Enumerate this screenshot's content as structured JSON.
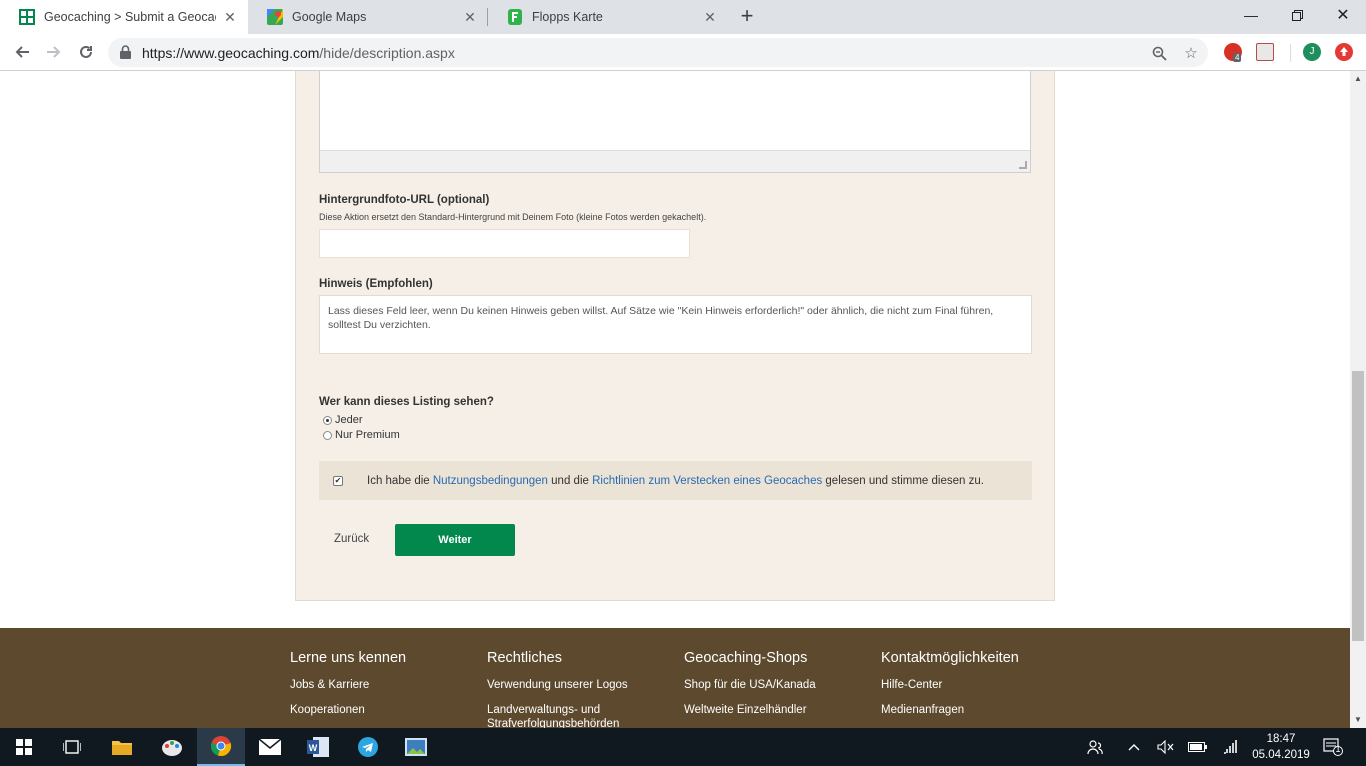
{
  "browser": {
    "tabs": [
      {
        "title": "Geocaching > Submit a Geocach",
        "active": true,
        "icon": "geocaching-icon"
      },
      {
        "title": "Google Maps",
        "active": false,
        "icon": "google-maps-icon"
      },
      {
        "title": "Flopps Karte",
        "active": false,
        "icon": "flopps-icon"
      }
    ],
    "url_domain": "https://www.geocaching.com",
    "url_path": "/hide/description.aspx",
    "profile_initial": "J",
    "extension_badge": "4"
  },
  "form": {
    "background_label": "Hintergrundfoto-URL (optional)",
    "background_hint": "Diese Aktion ersetzt den Standard-Hintergrund mit Deinem Foto (kleine Fotos werden gekachelt).",
    "background_value": "",
    "hint_label": "Hinweis (Empfohlen)",
    "hint_placeholder": "Lass dieses Feld leer, wenn Du keinen Hinweis geben willst. Auf Sätze wie \"Kein Hinweis erforderlich!\" oder ähnlich, die nicht zum Final führen, solltest Du verzichten.",
    "visibility_label": "Wer kann dieses Listing sehen?",
    "visibility_options": [
      "Jeder",
      "Nur Premium"
    ],
    "visibility_selected": "Jeder",
    "terms_prefix": "Ich habe die ",
    "terms_link1": "Nutzungsbedingungen",
    "terms_middle": " und die ",
    "terms_link2": "Richtlinien zum Verstecken eines Geocaches",
    "terms_suffix": " gelesen und stimme diesen zu.",
    "terms_checked": true,
    "back_label": "Zurück",
    "next_label": "Weiter"
  },
  "footer": {
    "columns": [
      {
        "heading": "Lerne uns kennen",
        "links": [
          "Jobs & Karriere",
          "Kooperationen"
        ]
      },
      {
        "heading": "Rechtliches",
        "links": [
          "Verwendung unserer Logos",
          "Landverwaltungs- und Strafverfolgungsbehörden"
        ]
      },
      {
        "heading": "Geocaching-Shops",
        "links": [
          "Shop für die USA/Kanada",
          "Weltweite Einzelhändler"
        ]
      },
      {
        "heading": "Kontaktmöglichkeiten",
        "links": [
          "Hilfe-Center",
          "Medienanfragen"
        ]
      }
    ]
  },
  "taskbar": {
    "time": "18:47",
    "date": "05.04.2019",
    "notification_count": "1"
  },
  "colors": {
    "accent_green": "#02874d",
    "footer_brown": "#5d4a2e",
    "panel_beige": "#f5efe7",
    "link_blue": "#2a6ab0"
  }
}
